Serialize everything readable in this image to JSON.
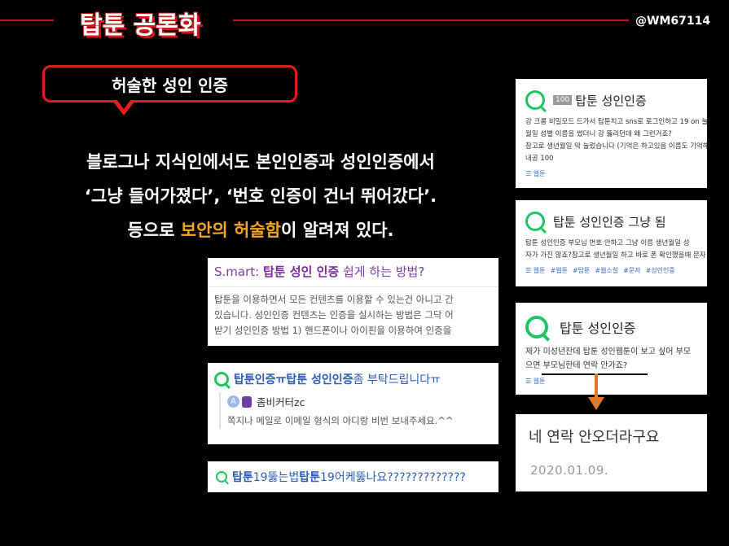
{
  "header": {
    "title": "탑툰 공론화",
    "handle": "@WM67114"
  },
  "bubble": {
    "text": "허술한 성인 인증"
  },
  "body": {
    "line1": "블로그나 지식인에서도 본인인증과 성인인증에서",
    "line2": "‘그냥 들어가졌다’, ‘번호 인증이 건너 뛰어갔다’.",
    "line3_pre": "등으로 ",
    "line3_hl": "보안의 허술함",
    "line3_post": "이 알려져 있다."
  },
  "smart_card": {
    "prefix": "S.mart: ",
    "bold": "탑툰 성인 인증",
    "suffix": " 쉽게 하는 방법?",
    "lines": [
      "탑툰을 이용하면서 모든 컨텐츠를 이용할 수 있는건 아니고 간",
      "있습니다. 성인인증 컨텐츠는 인증을 실시하는 방법은 그닥 어",
      "받기 성인인증 방법 1) 핸드폰이나 아이핀을 이용하여 인증을"
    ]
  },
  "request_card": {
    "t1": "탑툰인증ㅠ ",
    "t2": "탑툰 성인인증",
    "t3": "좀 부탁드립니다ㅠ",
    "avatar": "A",
    "user": "좀비커터zc",
    "msg": "쪽지나 메일로 이메일 형식의 아디랑 비번 보내주세요.^^"
  },
  "card19": {
    "b1": "탑툰",
    "t1": "19뚫는법 ",
    "b2": "탑툰",
    "t2": "19어케뚫나요?????????????"
  },
  "right_cards": {
    "r1": {
      "badge": "100",
      "title": "탑툰 성인인증",
      "lines": [
        "강 크롬 비밀모드 드가서 탑툰치고 sns로 로그인하고 19 on 눌",
        "월일 성별 이름을 썼더니 강 뚫리던데 왜 그런거죠?",
        "참고로 생년월일 막 눌렀습니다 (기억은 하고있음 이름도 기억해",
        "내공 100"
      ],
      "foot": "웹툰"
    },
    "r2": {
      "title": "탑툰 성인인증 그냥 됨",
      "lines": [
        "탑툰 성인인증 부모님 번호 안하고 그냥 이름 생년월일 성",
        "자가 가진 않죠?참고로 생년월일 하고 바로 폰 확인했을때 문자"
      ],
      "tags": [
        "웹툰",
        "#웹툰",
        "#탑툰",
        "#웹소설",
        "#문자",
        "#성인인증"
      ]
    },
    "r3": {
      "title": "탑툰 성인인증",
      "lines": [
        "제가 미성년잔데 탑툰 성인웹툰이 보고 싶어 부모",
        "으면 부모님한테 연락 안가죠?"
      ],
      "foot": "웹툰"
    },
    "r4": {
      "msg": "네 연락 안오더라구요",
      "date": "2020.01.09."
    }
  },
  "colors": {
    "accent_red": "#e01e1e",
    "highlight": "#f5a623",
    "naver_green": "#1dc462",
    "arrow": "#e07a2a"
  }
}
